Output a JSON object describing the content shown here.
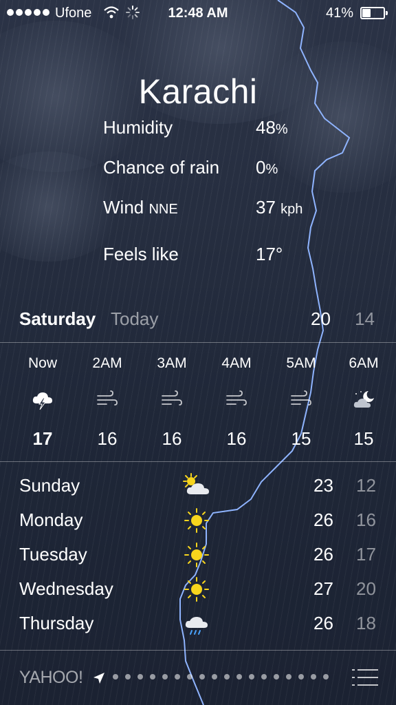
{
  "status_bar": {
    "carrier": "Ufone",
    "time": "12:48 AM",
    "battery_percent": "41%",
    "battery_level": 0.41,
    "signal_dots": 5,
    "icons": [
      "signal-dots-icon",
      "wifi-icon",
      "activity-spinner-icon",
      "battery-icon"
    ]
  },
  "city": "Karachi",
  "details": [
    {
      "label": "Humidity",
      "label_small": "",
      "value": "48",
      "unit": "%"
    },
    {
      "label": "Chance of rain",
      "label_small": "",
      "value": "0",
      "unit": "%"
    },
    {
      "label": "Wind",
      "label_small": "NNE",
      "value": "37",
      "unit": "kph"
    },
    {
      "label": "Feels like",
      "label_small": "",
      "value": "17°",
      "unit": ""
    }
  ],
  "today": {
    "day": "Saturday",
    "relative": "Today",
    "high": "20",
    "low": "14"
  },
  "hourly": [
    {
      "time": "Now",
      "icon": "thunderstorm-icon",
      "temp": "17"
    },
    {
      "time": "2AM",
      "icon": "wind-icon",
      "temp": "16"
    },
    {
      "time": "3AM",
      "icon": "wind-icon",
      "temp": "16"
    },
    {
      "time": "4AM",
      "icon": "wind-icon",
      "temp": "16"
    },
    {
      "time": "5AM",
      "icon": "wind-icon",
      "temp": "15"
    },
    {
      "time": "6AM",
      "icon": "partly-cloudy-night-icon",
      "temp": "15"
    }
  ],
  "daily": [
    {
      "day": "Sunday",
      "icon": "partly-sunny-icon",
      "high": "23",
      "low": "12"
    },
    {
      "day": "Monday",
      "icon": "sunny-icon",
      "high": "26",
      "low": "16"
    },
    {
      "day": "Tuesday",
      "icon": "sunny-icon",
      "high": "26",
      "low": "17"
    },
    {
      "day": "Wednesday",
      "icon": "sunny-icon",
      "high": "27",
      "low": "20"
    },
    {
      "day": "Thursday",
      "icon": "rain-icon",
      "high": "26",
      "low": "18"
    }
  ],
  "footer": {
    "brand": "YAHOO!",
    "page_dots": 18,
    "icons": [
      "location-arrow-icon",
      "list-icon"
    ]
  },
  "colors": {
    "sun": "#f7d51d",
    "lightning": "#8fb4ff",
    "background": "#262e40"
  }
}
